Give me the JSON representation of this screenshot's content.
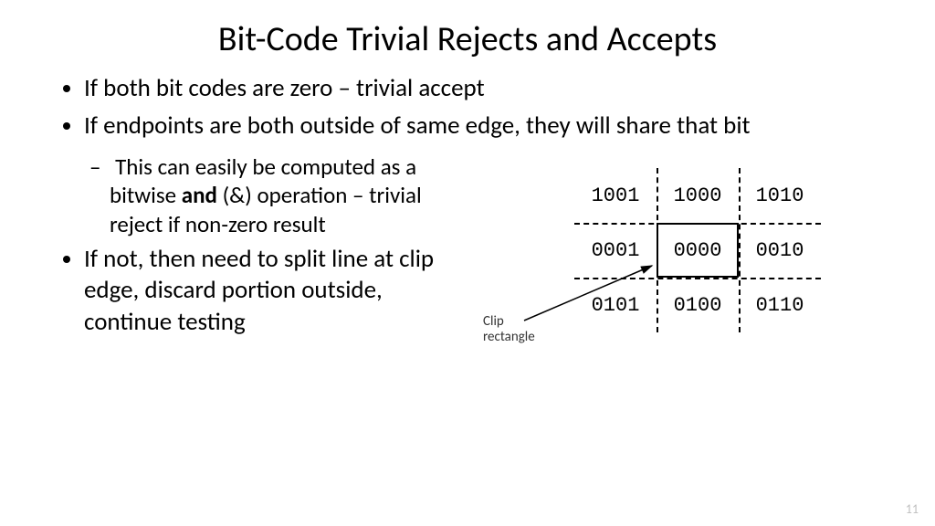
{
  "title": "Bit-Code Trivial Rejects and Accepts",
  "bullets": {
    "b1": "If both bit codes are zero – trivial accept",
    "b2": "If endpoints are both outside of same edge, they will share that bit",
    "b2a_pre": "This can easily be computed as a bitwise ",
    "b2a_bold": "and",
    "b2a_post": " (&) operation – trivial reject if non-zero result",
    "b3": "If not, then need to split line at clip edge, discard portion outside, continue testing"
  },
  "grid": [
    [
      "1001",
      "1000",
      "1010"
    ],
    [
      "0001",
      "0000",
      "0010"
    ],
    [
      "0101",
      "0100",
      "0110"
    ]
  ],
  "clip_label_line1": "Clip",
  "clip_label_line2": "rectangle",
  "page_number": "11"
}
